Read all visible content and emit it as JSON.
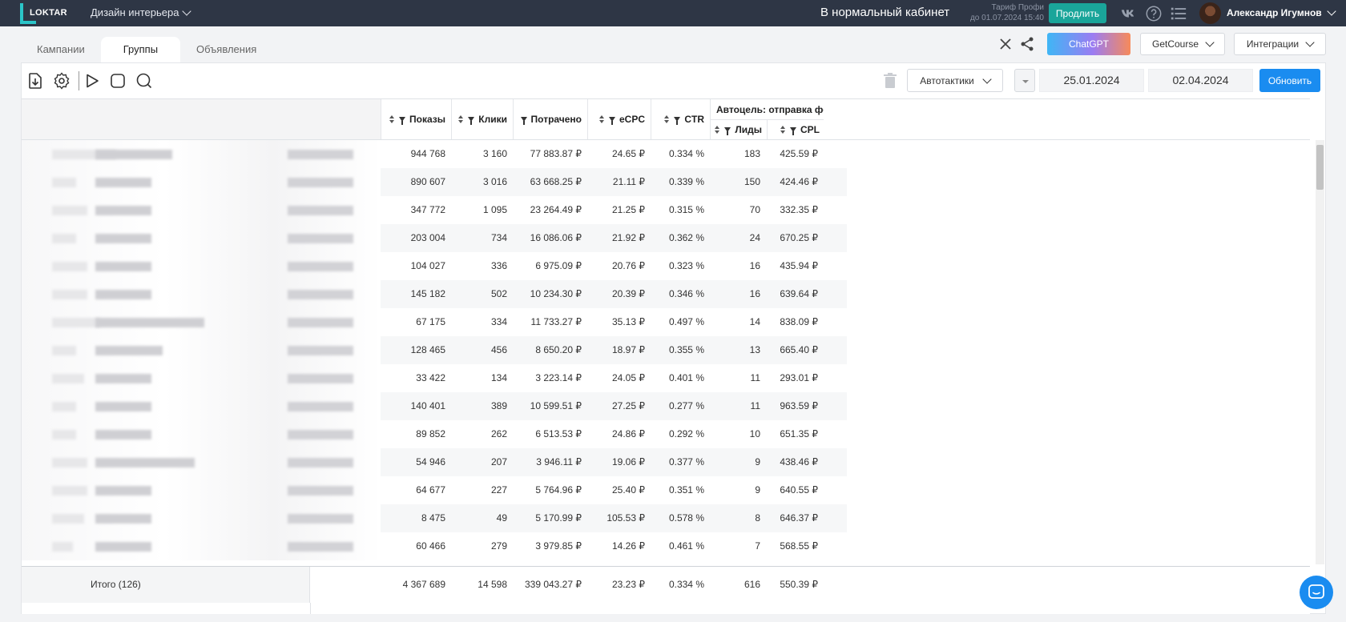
{
  "topbar": {
    "logo_text": "LOKTAR",
    "project": "Дизайн интерьера",
    "cabinet_title": "В нормальный кабинет",
    "tariff_line1": "Тариф Профи",
    "tariff_line2": "до 01.07.2024 15:40",
    "prolong_label": "Продлить",
    "user_name": "Александр Игумнов"
  },
  "tabs": [
    {
      "label": "Кампании"
    },
    {
      "label": "Группы"
    },
    {
      "label": "Объявления"
    }
  ],
  "header": {
    "chatgpt_label": "ChatGPT",
    "getcourse_label": "GetCourse",
    "integrations_label": "Интеграции"
  },
  "toolbar": {
    "autotactics_label": "Автотактики",
    "date_from": "25.01.2024",
    "date_to": "02.04.2024",
    "refresh_label": "Обновить"
  },
  "table": {
    "columns": {
      "shows": "Показы",
      "clicks": "Клики",
      "spent": "Потрачено",
      "ecpc": "eCPC",
      "ctr": "CTR",
      "group": "Автоцель: отправка формы",
      "leads": "Лиды",
      "cpl": "CPL"
    },
    "rows": [
      {
        "shows": "944 768",
        "clicks": "3 160",
        "spent": "77 883.87 ₽",
        "ecpc": "24.65 ₽",
        "ctr": "0.334 %",
        "leads": "183",
        "cpl": "425.59 ₽"
      },
      {
        "shows": "890 607",
        "clicks": "3 016",
        "spent": "63 668.25 ₽",
        "ecpc": "21.11 ₽",
        "ctr": "0.339 %",
        "leads": "150",
        "cpl": "424.46 ₽"
      },
      {
        "shows": "347 772",
        "clicks": "1 095",
        "spent": "23 264.49 ₽",
        "ecpc": "21.25 ₽",
        "ctr": "0.315 %",
        "leads": "70",
        "cpl": "332.35 ₽"
      },
      {
        "shows": "203 004",
        "clicks": "734",
        "spent": "16 086.06 ₽",
        "ecpc": "21.92 ₽",
        "ctr": "0.362 %",
        "leads": "24",
        "cpl": "670.25 ₽"
      },
      {
        "shows": "104 027",
        "clicks": "336",
        "spent": "6 975.09 ₽",
        "ecpc": "20.76 ₽",
        "ctr": "0.323 %",
        "leads": "16",
        "cpl": "435.94 ₽"
      },
      {
        "shows": "145 182",
        "clicks": "502",
        "spent": "10 234.30 ₽",
        "ecpc": "20.39 ₽",
        "ctr": "0.346 %",
        "leads": "16",
        "cpl": "639.64 ₽"
      },
      {
        "shows": "67 175",
        "clicks": "334",
        "spent": "11 733.27 ₽",
        "ecpc": "35.13 ₽",
        "ctr": "0.497 %",
        "leads": "14",
        "cpl": "838.09 ₽"
      },
      {
        "shows": "128 465",
        "clicks": "456",
        "spent": "8 650.20 ₽",
        "ecpc": "18.97 ₽",
        "ctr": "0.355 %",
        "leads": "13",
        "cpl": "665.40 ₽"
      },
      {
        "shows": "33 422",
        "clicks": "134",
        "spent": "3 223.14 ₽",
        "ecpc": "24.05 ₽",
        "ctr": "0.401 %",
        "leads": "11",
        "cpl": "293.01 ₽"
      },
      {
        "shows": "140 401",
        "clicks": "389",
        "spent": "10 599.51 ₽",
        "ecpc": "27.25 ₽",
        "ctr": "0.277 %",
        "leads": "11",
        "cpl": "963.59 ₽"
      },
      {
        "shows": "89 852",
        "clicks": "262",
        "spent": "6 513.53 ₽",
        "ecpc": "24.86 ₽",
        "ctr": "0.292 %",
        "leads": "10",
        "cpl": "651.35 ₽"
      },
      {
        "shows": "54 946",
        "clicks": "207",
        "spent": "3 946.11 ₽",
        "ecpc": "19.06 ₽",
        "ctr": "0.377 %",
        "leads": "9",
        "cpl": "438.46 ₽"
      },
      {
        "shows": "64 677",
        "clicks": "227",
        "spent": "5 764.96 ₽",
        "ecpc": "25.40 ₽",
        "ctr": "0.351 %",
        "leads": "9",
        "cpl": "640.55 ₽"
      },
      {
        "shows": "8 475",
        "clicks": "49",
        "spent": "5 170.99 ₽",
        "ecpc": "105.53 ₽",
        "ctr": "0.578 %",
        "leads": "8",
        "cpl": "646.37 ₽"
      },
      {
        "shows": "60 466",
        "clicks": "279",
        "spent": "3 979.85 ₽",
        "ecpc": "14.26 ₽",
        "ctr": "0.461 %",
        "leads": "7",
        "cpl": "568.55 ₽"
      }
    ],
    "total": {
      "label": "Итого (126)",
      "shows": "4 367 689",
      "clicks": "14 598",
      "spent": "339 043.27 ₽",
      "ecpc": "23.23 ₽",
      "ctr": "0.334 %",
      "leads": "616",
      "cpl": "550.39 ₽"
    }
  },
  "colors": {
    "topbar_bg": "#2e3645",
    "prolong_bg": "#1aa59a",
    "accent_blue": "#1a8cf0"
  },
  "icons": [
    "import-icon",
    "settings-icon",
    "play-icon",
    "stop-icon",
    "search-icon",
    "trash-icon",
    "close-icon",
    "share-icon",
    "vk-icon",
    "help-icon",
    "list-icon",
    "chat-icon"
  ]
}
